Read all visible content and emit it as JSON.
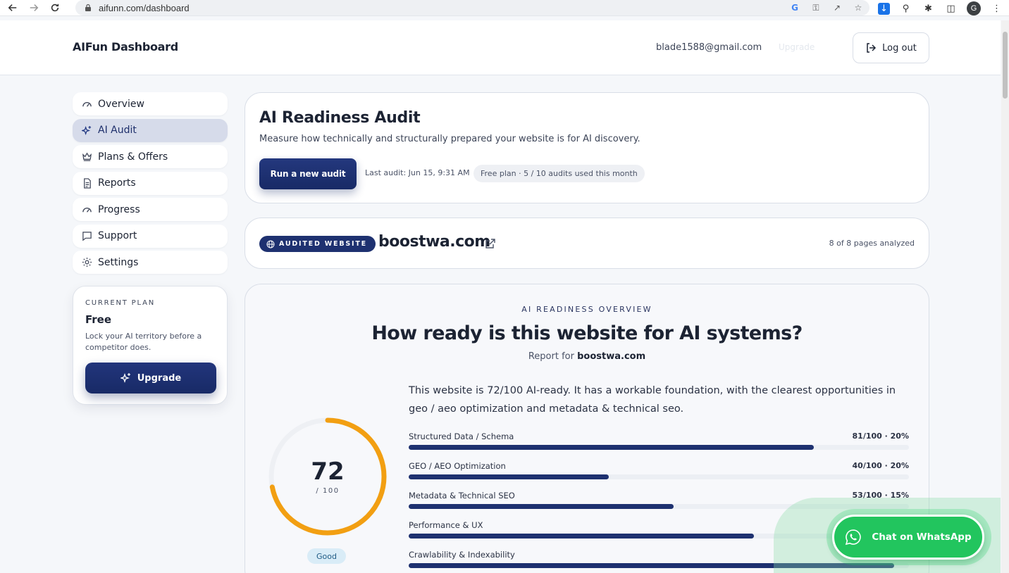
{
  "browser": {
    "url": "aifunn.com/dashboard",
    "profile_initial": "G"
  },
  "header": {
    "brand": "AIFun Dashboard",
    "user_email": "blade1588@gmail.com",
    "upgrade_ghost": "Upgrade",
    "logout_label": "Log out"
  },
  "sidebar": {
    "items": [
      {
        "label": "Overview",
        "icon": "gauge-icon"
      },
      {
        "label": "AI Audit",
        "icon": "sparkles-icon",
        "active": true
      },
      {
        "label": "Plans & Offers",
        "icon": "crown-icon"
      },
      {
        "label": "Reports",
        "icon": "document-icon"
      },
      {
        "label": "Progress",
        "icon": "gauge-icon"
      },
      {
        "label": "Support",
        "icon": "chat-icon"
      },
      {
        "label": "Settings",
        "icon": "gear-icon"
      }
    ]
  },
  "plan": {
    "kicker": "CURRENT PLAN",
    "name": "Free",
    "description": "Lock your AI territory before a competitor does.",
    "upgrade_label": "Upgrade"
  },
  "audit": {
    "title": "AI Readiness Audit",
    "subtitle": "Measure how technically and structurally prepared your website is for AI discovery.",
    "run_label": "Run a new audit",
    "last_audit": "Last audit: Jun 15, 9:31 AM",
    "plan_usage": "Free plan · 5 / 10 audits used this month"
  },
  "site": {
    "badge": "AUDITED WEBSITE",
    "domain": "boostwa.com",
    "pages_analyzed": "8 of 8 pages analyzed"
  },
  "overview": {
    "kicker": "AI READINESS OVERVIEW",
    "title": "How ready is this website for AI systems?",
    "report_prefix": "Report for",
    "report_domain": "boostwa.com",
    "summary": "This website is 72/100 AI-ready. It has a workable foundation, with the clearest opportunities in geo / aeo optimization and metadata & technical seo.",
    "score": "72",
    "score_max": "/ 100",
    "score_value": 72,
    "rating": "Good",
    "gauge_color": "#f29f12",
    "metrics": [
      {
        "label": "Structured Data / Schema",
        "value": "81/100 · 20%",
        "score": 81
      },
      {
        "label": "GEO / AEO Optimization",
        "value": "40/100 · 20%",
        "score": 40
      },
      {
        "label": "Metadata & Technical SEO",
        "value": "53/100 · 15%",
        "score": 53
      },
      {
        "label": "Performance & UX",
        "value": "",
        "score": 69
      },
      {
        "label": "Crawlability & Indexability",
        "value": "",
        "score": 97
      }
    ]
  },
  "whatsapp": {
    "label": "Chat on WhatsApp"
  },
  "colors": {
    "accent": "#1e3170",
    "whatsapp": "#22c55e"
  }
}
